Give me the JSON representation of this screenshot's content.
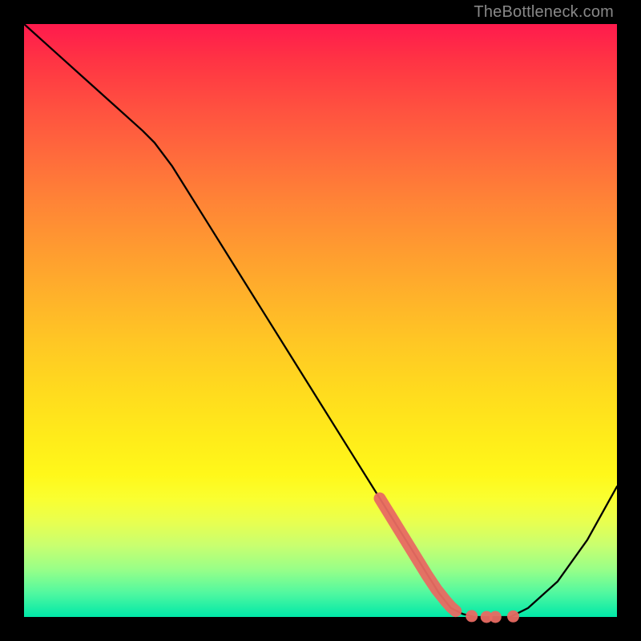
{
  "watermark": "TheBottleneck.com",
  "colors": {
    "background": "#000000",
    "curve_stroke": "#000000",
    "marker_fill": "#e86a62",
    "marker_stroke": "#c94f47"
  },
  "chart_data": {
    "type": "line",
    "title": "",
    "xlabel": "",
    "ylabel": "",
    "xlim": [
      0,
      100
    ],
    "ylim": [
      0,
      100
    ],
    "grid": false,
    "legend": false,
    "series": [
      {
        "name": "bottleneck-curve",
        "x": [
          0,
          5,
          10,
          15,
          20,
          22,
          25,
          30,
          35,
          40,
          45,
          50,
          55,
          60,
          65,
          70,
          72,
          74,
          76,
          78,
          80,
          82,
          85,
          90,
          95,
          100
        ],
        "y": [
          100,
          95.5,
          91,
          86.5,
          82,
          80,
          76,
          68,
          60,
          52,
          44,
          36,
          28,
          20,
          12,
          4,
          1.5,
          0.5,
          0,
          0,
          0,
          0,
          1.5,
          6,
          13,
          22
        ]
      }
    ],
    "markers": [
      {
        "name": "highlight-segment",
        "style": "thick-dotted",
        "points": [
          {
            "x": 60.0,
            "y": 20.0
          },
          {
            "x": 60.8,
            "y": 18.7
          },
          {
            "x": 61.6,
            "y": 17.4
          },
          {
            "x": 62.4,
            "y": 16.1
          },
          {
            "x": 63.2,
            "y": 14.8
          },
          {
            "x": 64.0,
            "y": 13.5
          },
          {
            "x": 64.8,
            "y": 12.2
          },
          {
            "x": 65.6,
            "y": 10.9
          },
          {
            "x": 66.4,
            "y": 9.6
          },
          {
            "x": 67.2,
            "y": 8.3
          },
          {
            "x": 68.0,
            "y": 7.0
          },
          {
            "x": 68.8,
            "y": 5.8
          },
          {
            "x": 69.6,
            "y": 4.6
          },
          {
            "x": 70.4,
            "y": 3.6
          },
          {
            "x": 71.2,
            "y": 2.6
          },
          {
            "x": 72.0,
            "y": 1.7
          },
          {
            "x": 72.8,
            "y": 1.0
          }
        ]
      },
      {
        "name": "highlight-flat-dots",
        "style": "dots",
        "points": [
          {
            "x": 75.5,
            "y": 0.15
          },
          {
            "x": 78.0,
            "y": 0.0
          },
          {
            "x": 79.5,
            "y": 0.0
          },
          {
            "x": 82.5,
            "y": 0.1
          }
        ]
      }
    ]
  }
}
